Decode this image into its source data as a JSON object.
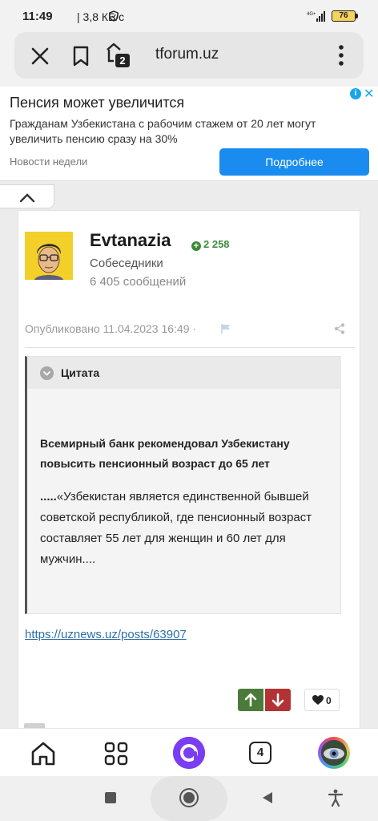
{
  "status": {
    "time": "11:49",
    "network_speed": "| 3,8 КБ/с",
    "signal_label": "4G+",
    "battery": "76"
  },
  "browser": {
    "url": "tforum.uz",
    "tabs_count": "2"
  },
  "ad": {
    "title": "Пенсия может увеличится",
    "text": "Гражданам Узбекистана с рабочим стажем от 20 лет могут увеличить пенсию сразу на 30%",
    "source": "Новости недели",
    "button": "Подробнее",
    "info_icon": "i",
    "close_icon": "✕"
  },
  "post": {
    "username": "Evtanazia",
    "reputation": "2 258",
    "group": "Собеседники",
    "posts_count": "6 405 сообщений",
    "date": "Опубликовано 11.04.2023 16:49 ·",
    "quote": {
      "label": "Цитата",
      "heading": "Всемирный банк рекомендовал Узбекистану повысить пенсионный возраст до 65 лет",
      "body_prefix": ".....",
      "body": "«Узбекистан является единственной бывшей советской республикой, где пенсионный возраст составляет 55 лет для женщин и 60 лет для мужчин...."
    },
    "link": "https://uznews.uz/posts/63907",
    "likes": "0"
  },
  "bottom_nav": {
    "tabs_count": "4"
  },
  "colors": {
    "accent": "#1a8cf0",
    "upvote": "#4c7a3a",
    "downvote": "#b33234",
    "reputation": "#3d8b3d",
    "link": "#2d6fa8",
    "alice": "#7a3df3"
  }
}
